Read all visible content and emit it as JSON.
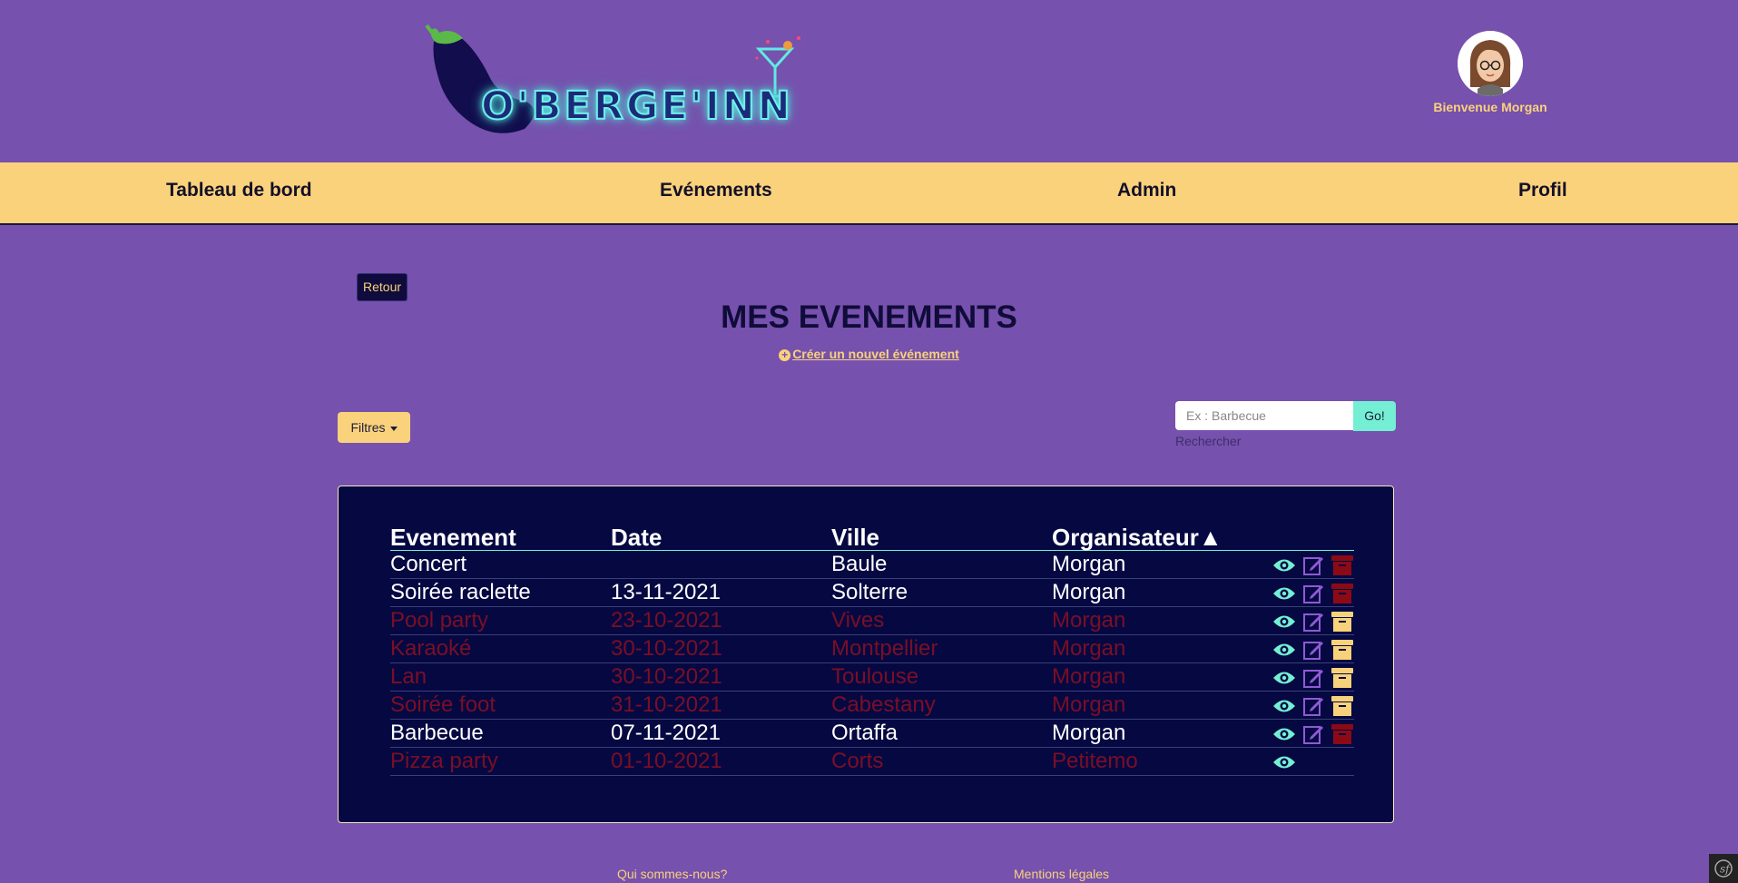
{
  "header": {
    "logo_text": "O'BERGE'INN",
    "welcome": "Bienvenue Morgan"
  },
  "nav": {
    "items": [
      {
        "label": "Tableau de bord"
      },
      {
        "label": "Evénements"
      },
      {
        "label": "Admin"
      },
      {
        "label": "Profil"
      }
    ]
  },
  "main": {
    "back_label": "Retour",
    "title": "MES EVENEMENTS",
    "create_label": "Créer un nouvel événement",
    "create_icon": "plus-circle-icon",
    "filters_label": "Filtres",
    "search": {
      "placeholder": "Ex : Barbecue",
      "button": "Go!",
      "label": "Rechercher"
    }
  },
  "table": {
    "headers": [
      "Evenement",
      "Date",
      "Ville",
      "Organisateur▲"
    ],
    "rows": [
      {
        "name": "Concert",
        "date": "",
        "city": "Baule",
        "organizer": "Morgan",
        "status": "active",
        "icons": [
          "eye-icon",
          "edit-icon",
          "archive-icon"
        ]
      },
      {
        "name": "Soirée raclette",
        "date": "13-11-2021",
        "city": "Solterre",
        "organizer": "Morgan",
        "status": "active",
        "icons": [
          "eye-icon",
          "edit-icon",
          "archive-icon"
        ]
      },
      {
        "name": "Pool party",
        "date": "23-10-2021",
        "city": "Vives",
        "organizer": "Morgan",
        "status": "past",
        "icons": [
          "eye-icon",
          "edit-icon",
          "unarchive-icon"
        ]
      },
      {
        "name": "Karaoké",
        "date": "30-10-2021",
        "city": "Montpellier",
        "organizer": "Morgan",
        "status": "past",
        "icons": [
          "eye-icon",
          "edit-icon",
          "unarchive-icon"
        ]
      },
      {
        "name": "Lan",
        "date": "30-10-2021",
        "city": "Toulouse",
        "organizer": "Morgan",
        "status": "past",
        "icons": [
          "eye-icon",
          "edit-icon",
          "unarchive-icon"
        ]
      },
      {
        "name": "Soirée foot",
        "date": "31-10-2021",
        "city": "Cabestany",
        "organizer": "Morgan",
        "status": "past",
        "icons": [
          "eye-icon",
          "edit-icon",
          "unarchive-icon"
        ]
      },
      {
        "name": "Barbecue",
        "date": "07-11-2021",
        "city": "Ortaffa",
        "organizer": "Morgan",
        "status": "active",
        "icons": [
          "eye-icon",
          "edit-icon",
          "archive-icon"
        ]
      },
      {
        "name": "Pizza party",
        "date": "01-10-2021",
        "city": "Corts",
        "organizer": "Petitemo",
        "status": "past",
        "icons": [
          "eye-icon"
        ]
      }
    ]
  },
  "footer": {
    "links": [
      "Qui sommes-nous?",
      "Mentions légales"
    ]
  },
  "colors": {
    "background": "#7651ad",
    "nav": "#fad27b",
    "accent": "#f8d27a",
    "panel": "#060842",
    "teal": "#74efd3",
    "past_text": "#7a0f25",
    "archive_red": "#8b0a16"
  }
}
